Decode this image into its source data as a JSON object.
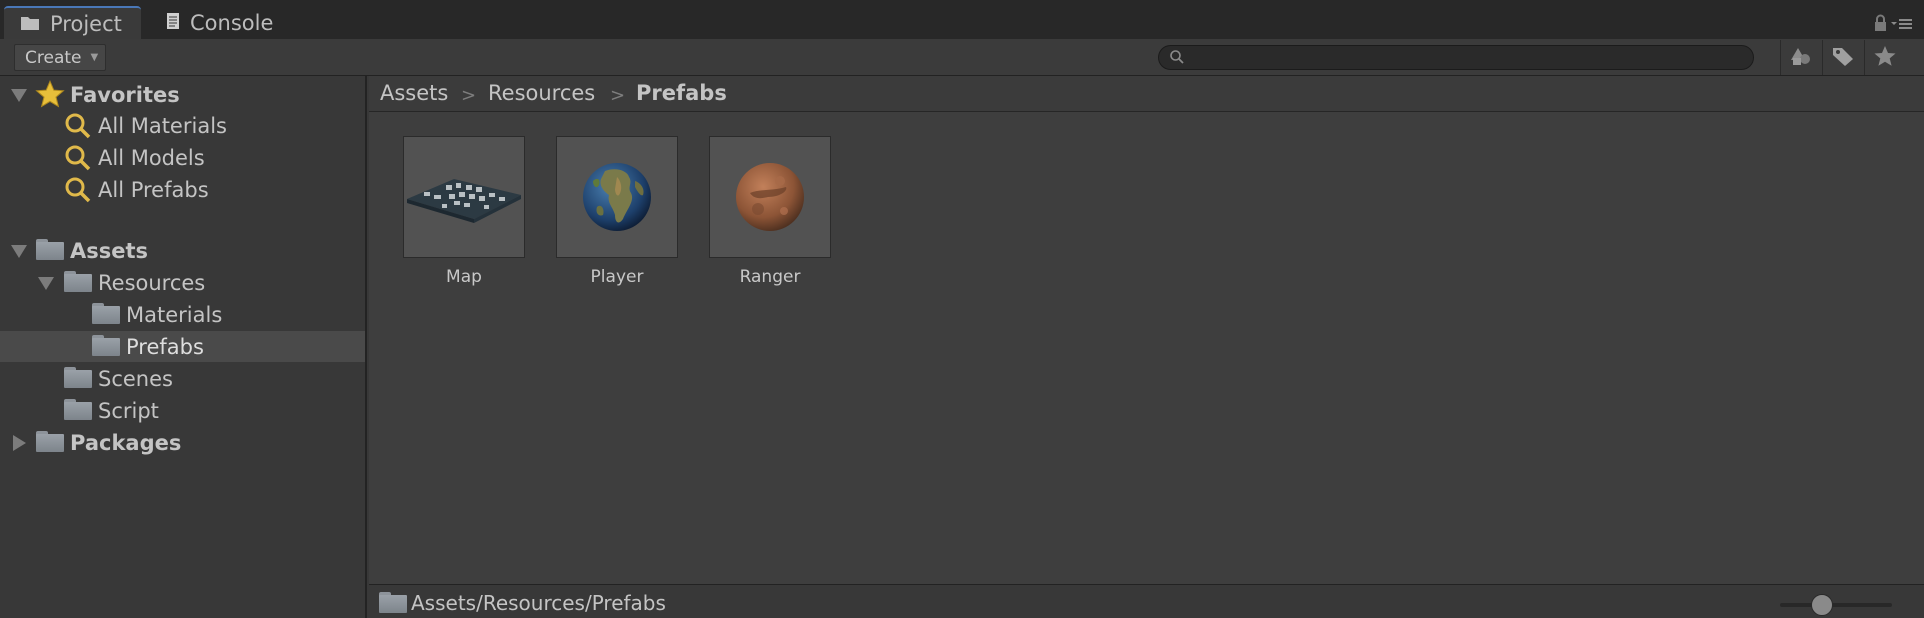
{
  "tabs": [
    {
      "label": "Project",
      "icon": "folder-icon",
      "active": true
    },
    {
      "label": "Console",
      "icon": "console-icon",
      "active": false
    }
  ],
  "toolbar": {
    "create_label": "Create",
    "search_placeholder": ""
  },
  "tree": {
    "favorites_label": "Favorites",
    "favorites": [
      "All Materials",
      "All Models",
      "All Prefabs"
    ],
    "assets_label": "Assets",
    "resources_label": "Resources",
    "materials_label": "Materials",
    "prefabs_label": "Prefabs",
    "scenes_label": "Scenes",
    "script_label": "Script",
    "packages_label": "Packages",
    "selected": "Prefabs"
  },
  "breadcrumb": [
    "Assets",
    "Resources",
    "Prefabs"
  ],
  "assets": [
    {
      "name": "Map",
      "icon": "map-prefab-thumbnail"
    },
    {
      "name": "Player",
      "icon": "earth-globe-thumbnail"
    },
    {
      "name": "Ranger",
      "icon": "mars-globe-thumbnail"
    }
  ],
  "status": {
    "path": "Assets/Resources/Prefabs"
  },
  "colors": {
    "accent": "#4a78b8",
    "favorites_star": "#e8bf3a",
    "search_icon": "#e0b94a"
  }
}
